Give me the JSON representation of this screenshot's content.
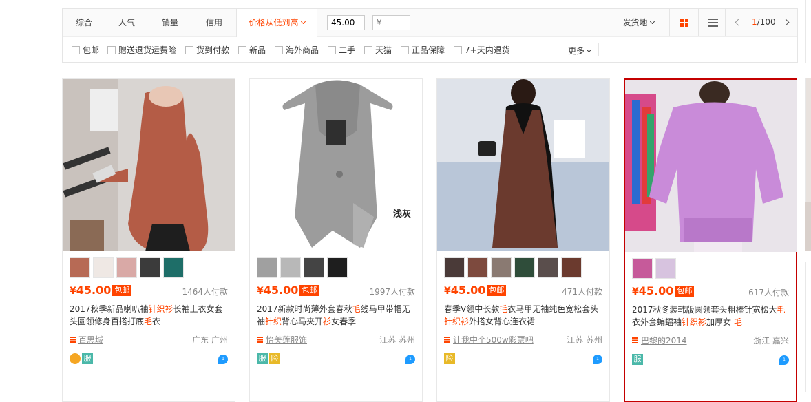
{
  "sort_tabs": [
    "综合",
    "人气",
    "销量",
    "信用",
    "价格从低到高"
  ],
  "price_filter": {
    "min_value": "45.00",
    "max_placeholder": "¥",
    "dash": "-"
  },
  "ship_from": "发货地",
  "pager": {
    "current": "1",
    "total": "/100"
  },
  "checkbox_filters": [
    "包邮",
    "赠送退货运费险",
    "货到付款",
    "新品",
    "海外商品",
    "二手",
    "天猫",
    "正品保障",
    "7+天内退货"
  ],
  "more_label": "更多",
  "colors": {
    "accent": "#ff4400",
    "hover_border": "#c40000",
    "service_teal": "#4bb8a9",
    "service_yellow": "#e8b928",
    "wangwang": "#1e9bff"
  },
  "products": [
    {
      "price_symbol": "¥",
      "price": "45.00",
      "tag": "包邮",
      "sales": "1464人付款",
      "title_parts": [
        "2017秋季新品喇叭袖",
        "针织衫",
        "长袖上衣女套头圆领修身百搭打底",
        "毛",
        "衣"
      ],
      "shop": "百思城",
      "location": "广东 广州",
      "badges": [
        "coin-icon",
        "服"
      ],
      "thumb_count": 5
    },
    {
      "price_symbol": "¥",
      "price": "45.00",
      "tag": "包邮",
      "sales": "1997人付款",
      "title_parts": [
        "2017新款时尚薄外套春秋",
        "毛",
        "线马甲带帽无袖",
        "针织",
        "背心马夹开",
        "衫",
        "女春季"
      ],
      "shop": "怡美莲服饰",
      "location": "江苏 苏州",
      "badges": [
        "服",
        "险"
      ],
      "image_caption": "浅灰",
      "thumb_count": 4
    },
    {
      "price_symbol": "¥",
      "price": "45.00",
      "tag": "包邮",
      "sales": "471人付款",
      "title_parts": [
        "春季V领中长款",
        "毛",
        "衣马甲无袖纯色宽松套头",
        "针织衫",
        "外搭女背心连衣裙"
      ],
      "shop": "让我中个500w彩票吧",
      "location": "江苏 苏州",
      "badges": [
        "险"
      ],
      "thumb_count": 6
    },
    {
      "price_symbol": "¥",
      "price": "45.00",
      "tag": "包邮",
      "sales": "617人付款",
      "title_parts": [
        "2017秋冬装韩版圆领套头粗棒针宽松大",
        "毛",
        "衣外套蝙蝠袖",
        "针织衫",
        "加厚女 ",
        "毛"
      ],
      "shop": "巴黎的2014",
      "location": "浙江 嘉兴",
      "badges": [
        "服"
      ],
      "thumb_count": 2
    }
  ]
}
